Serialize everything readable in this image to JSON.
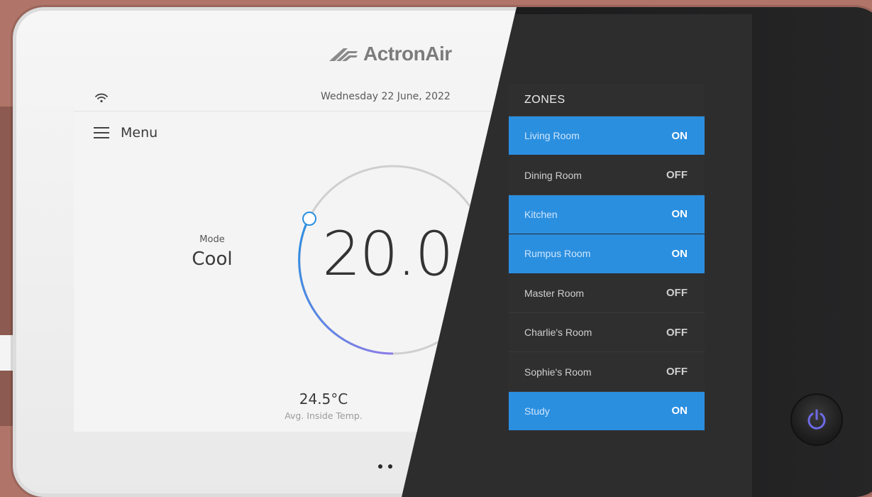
{
  "brand": {
    "logo_text": "ActronAir"
  },
  "status_bar": {
    "wifi_icon": "wifi-icon",
    "date": "Wednesday 22 June, 2022"
  },
  "menu": {
    "label": "Menu",
    "icon": "hamburger-icon"
  },
  "mode": {
    "caption": "Mode",
    "value": "Cool"
  },
  "setpoint": {
    "value": "20.0"
  },
  "inside": {
    "temp": "24.5°C",
    "caption": "Avg. Inside Temp."
  },
  "zones": {
    "title": "ZONES",
    "items": [
      {
        "name": "Living Room",
        "state": "ON"
      },
      {
        "name": "Dining Room",
        "state": "OFF"
      },
      {
        "name": "Kitchen",
        "state": "ON"
      },
      {
        "name": "Rumpus Room",
        "state": "ON"
      },
      {
        "name": "Master Room",
        "state": "OFF"
      },
      {
        "name": "Charlie's Room",
        "state": "OFF"
      },
      {
        "name": "Sophie's Room",
        "state": "OFF"
      },
      {
        "name": "Study",
        "state": "ON"
      }
    ]
  },
  "colors": {
    "accent_on": "#2b8fe0",
    "dial_gradient_start": "#2b8fe0",
    "dial_gradient_end": "#8b7be8",
    "power_icon": "#6d6ae6"
  },
  "power_button": {
    "icon": "power-icon"
  }
}
